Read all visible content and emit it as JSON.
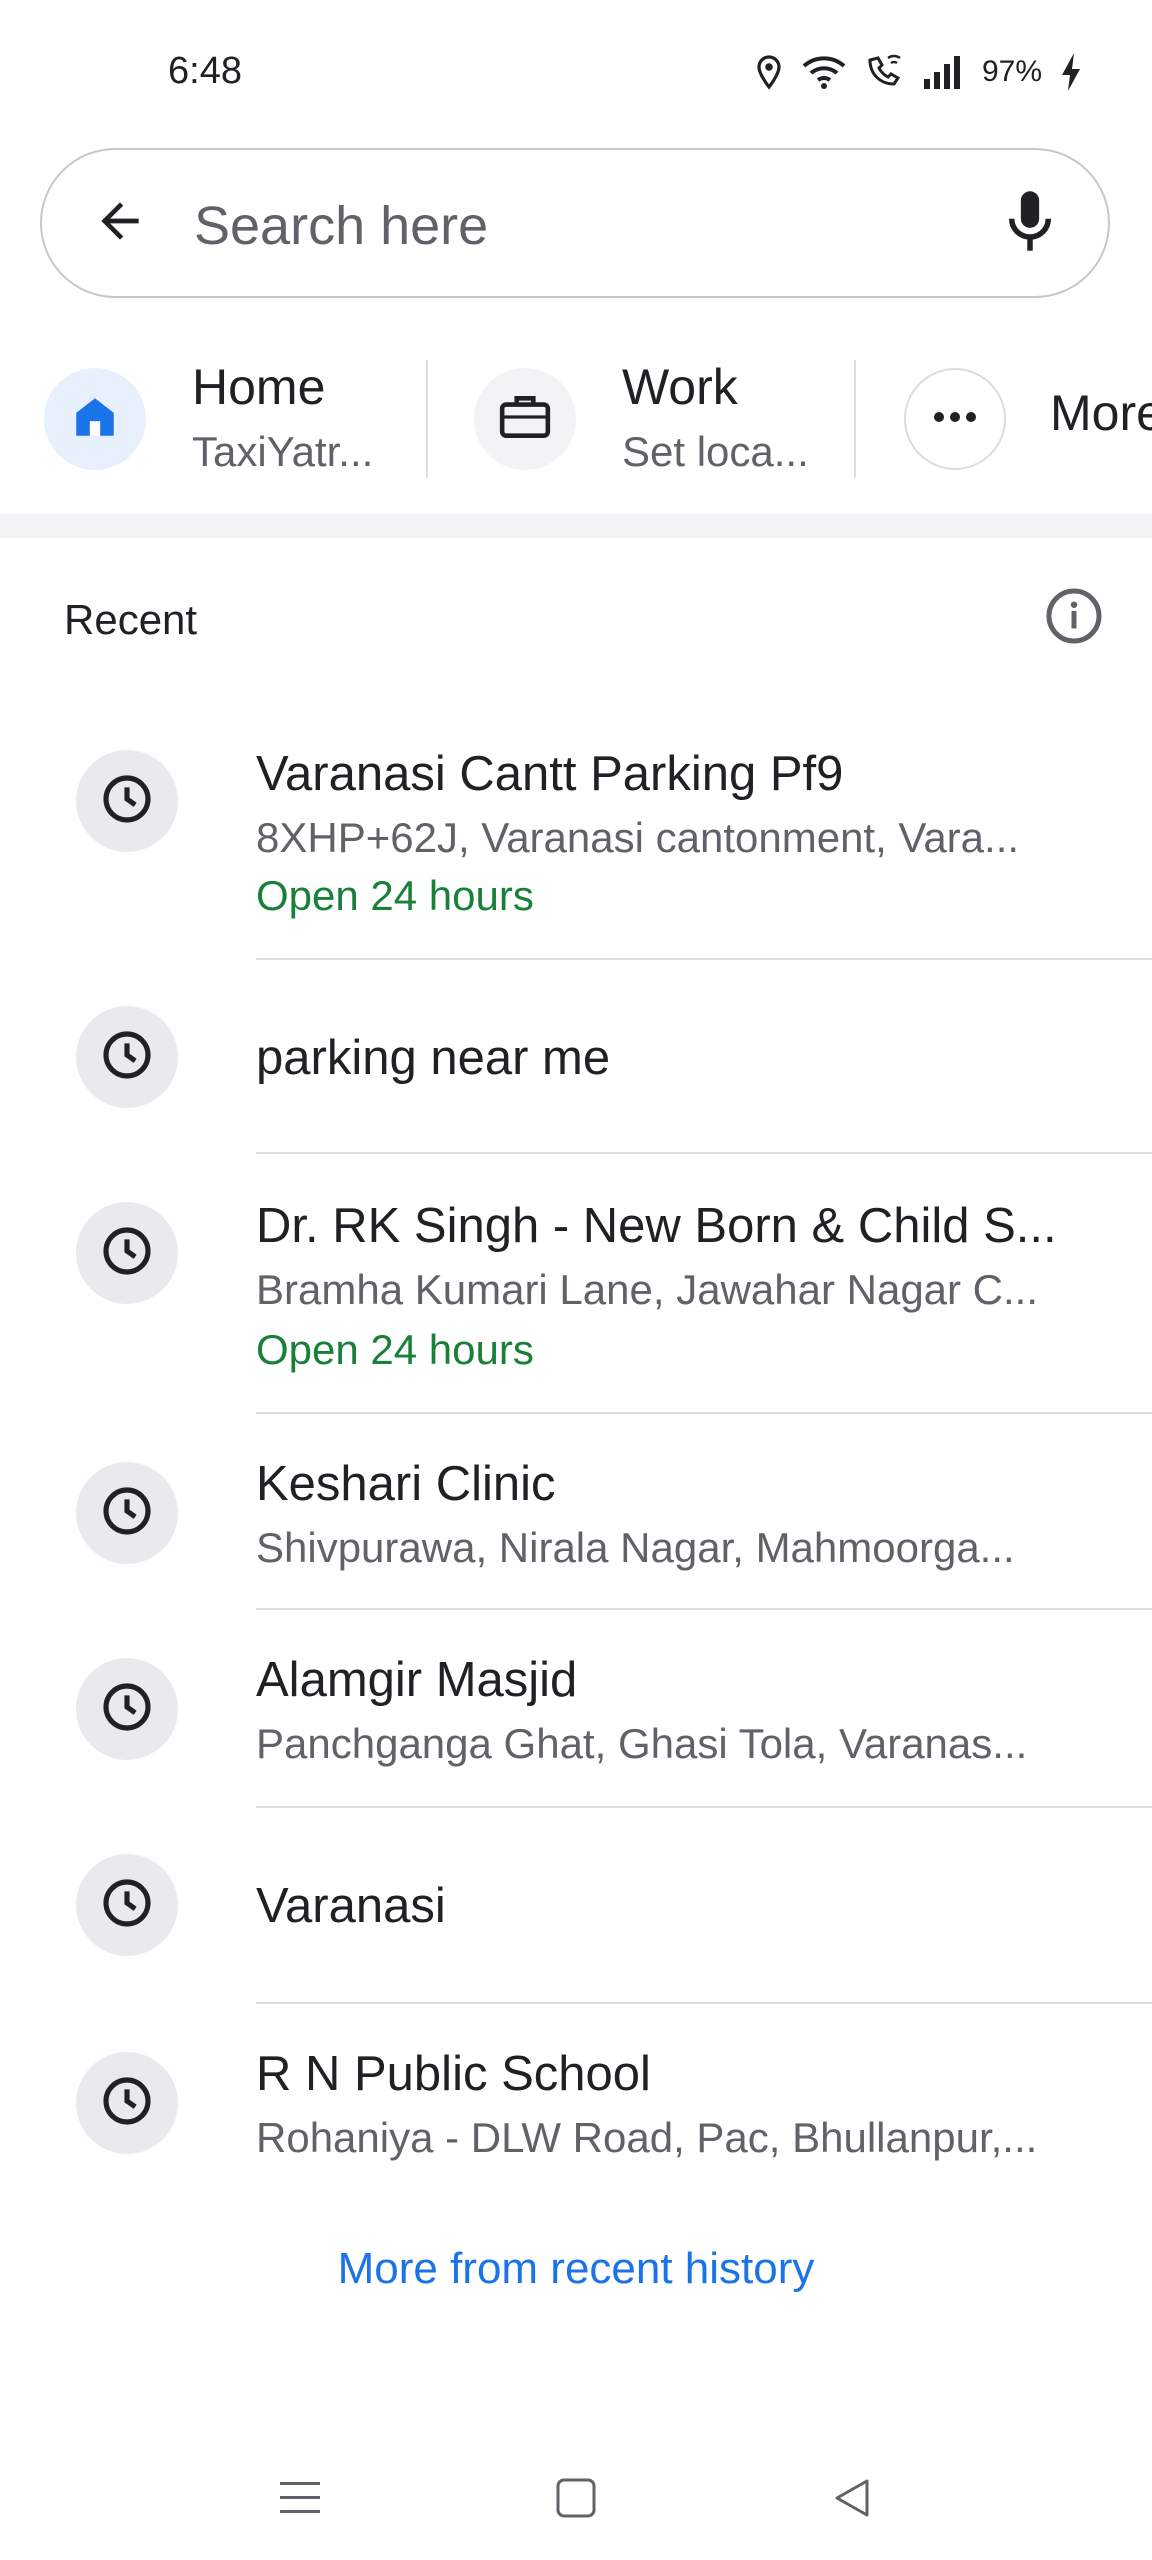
{
  "status_bar": {
    "time": "6:48",
    "battery": "97%",
    "icons": [
      "location-icon",
      "wifi-icon",
      "wifi-calling-icon",
      "signal-icon",
      "charging-icon"
    ]
  },
  "search": {
    "placeholder": "Search here",
    "back_icon": "arrow-left-icon",
    "mic_icon": "mic-icon"
  },
  "shortcuts": [
    {
      "title": "Home",
      "subtitle": "TaxiYatr...",
      "icon": "home-icon"
    },
    {
      "title": "Work",
      "subtitle": "Set loca...",
      "icon": "briefcase-icon"
    },
    {
      "title": "More",
      "icon": "more-horiz-icon"
    }
  ],
  "recent": {
    "title": "Recent",
    "info_icon": "info-icon",
    "items": [
      {
        "title": "Varanasi Cantt Parking Pf9",
        "subtitle": "8XHP+62J, Varanasi cantonment, Vara...",
        "status": "Open 24 hours"
      },
      {
        "title": "parking near me"
      },
      {
        "title": "Dr. RK Singh - New Born & Child S...",
        "subtitle": "Bramha Kumari Lane, Jawahar Nagar C...",
        "status": "Open 24 hours"
      },
      {
        "title": "Keshari Clinic",
        "subtitle": "Shivpurawa, Nirala Nagar, Mahmoorga..."
      },
      {
        "title": "Alamgir Masjid",
        "subtitle": "Panchganga Ghat, Ghasi Tola, Varanas..."
      },
      {
        "title": "Varanasi"
      },
      {
        "title": "R N Public School",
        "subtitle": "Rohaniya - DLW Road, Pac, Bhullanpur,..."
      }
    ],
    "more_link": "More from recent history"
  },
  "colors": {
    "accent": "#1a73e8",
    "open_status": "#188038",
    "secondary_text": "#5f6368",
    "icon_bg": "#e8eaed"
  }
}
